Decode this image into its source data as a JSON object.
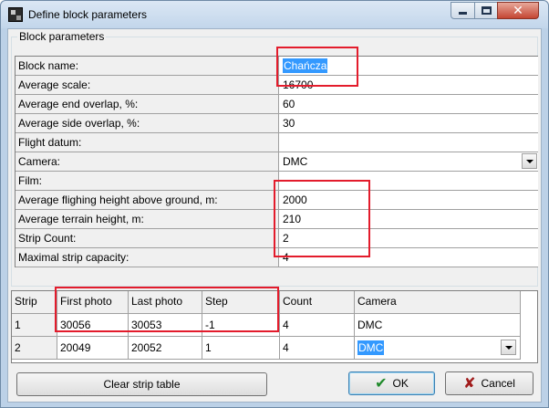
{
  "window": {
    "title": "Define block parameters",
    "icon": "app-grid-icon",
    "close_glyph": "✕"
  },
  "block_group": {
    "legend": "Block parameters",
    "rows": [
      {
        "label": "Block name:",
        "value": "Chańcza"
      },
      {
        "label": "Average scale:",
        "value": "16700"
      },
      {
        "label": "Average end overlap, %:",
        "value": "60"
      },
      {
        "label": "Average side overlap, %:",
        "value": "30"
      },
      {
        "label": "Flight datum:",
        "value": ""
      },
      {
        "label": "Camera:",
        "value": "DMC"
      },
      {
        "label": "Film:",
        "value": ""
      },
      {
        "label": "Average flighing height above ground, m:",
        "value": "2000"
      },
      {
        "label": "Average terrain height, m:",
        "value": "210"
      },
      {
        "label": "Strip Count:",
        "value": "2"
      },
      {
        "label": "Maximal strip capacity:",
        "value": "4"
      }
    ]
  },
  "strip_table": {
    "headers": [
      "Strip",
      "First photo",
      "Last photo",
      "Step",
      "Count",
      "Camera"
    ],
    "rows": [
      [
        "1",
        "30056",
        "30053",
        "-1",
        "4",
        "DMC"
      ],
      [
        "2",
        "20049",
        "20052",
        "1",
        "4",
        "DMC"
      ]
    ]
  },
  "buttons": {
    "clear": "Clear strip table",
    "ok": "OK",
    "cancel": "Cancel",
    "ok_icon": "✔",
    "cancel_icon": "✘"
  },
  "colors": {
    "highlight": "#e31c2c",
    "selection": "#3399ff"
  }
}
